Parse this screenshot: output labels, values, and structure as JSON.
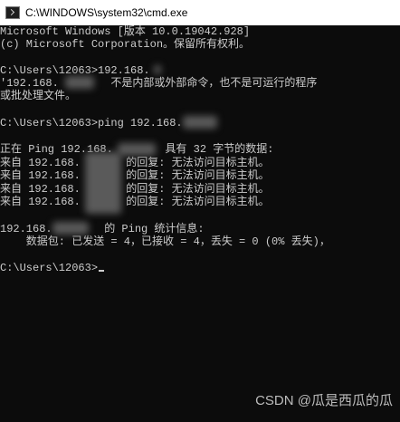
{
  "window": {
    "title": "C:\\WINDOWS\\system32\\cmd.exe",
    "icon": "cmd-icon"
  },
  "console": {
    "lines": [
      "Microsoft Windows [版本 10.0.19042.928]",
      "(c) Microsoft Corporation。保留所有权利。",
      "",
      "C:\\Users\\12063>192.168.",
      "'192.168.        不是内部或外部命令，也不是可运行的程序",
      "或批处理文件。",
      "",
      "C:\\Users\\12063>ping 192.168.",
      "",
      "正在 Ping 192.168.        具有 32 字节的数据:",
      "来自 192.168.       的回复: 无法访问目标主机。",
      "来自 192.168.       的回复: 无法访问目标主机。",
      "来自 192.168.       的回复: 无法访问目标主机。",
      "来自 192.168.       的回复: 无法访问目标主机。",
      "",
      "192.168.        的 Ping 统计信息:",
      "    数据包: 已发送 = 4，已接收 = 4，丢失 = 0 (0% 丢失)，",
      "",
      "C:\\Users\\12063>"
    ]
  },
  "watermark": {
    "text": "CSDN @瓜是西瓜的瓜"
  },
  "colors": {
    "console_bg": "#0c0c0c",
    "console_text": "#cccccc",
    "titlebar_bg": "#ffffff"
  }
}
